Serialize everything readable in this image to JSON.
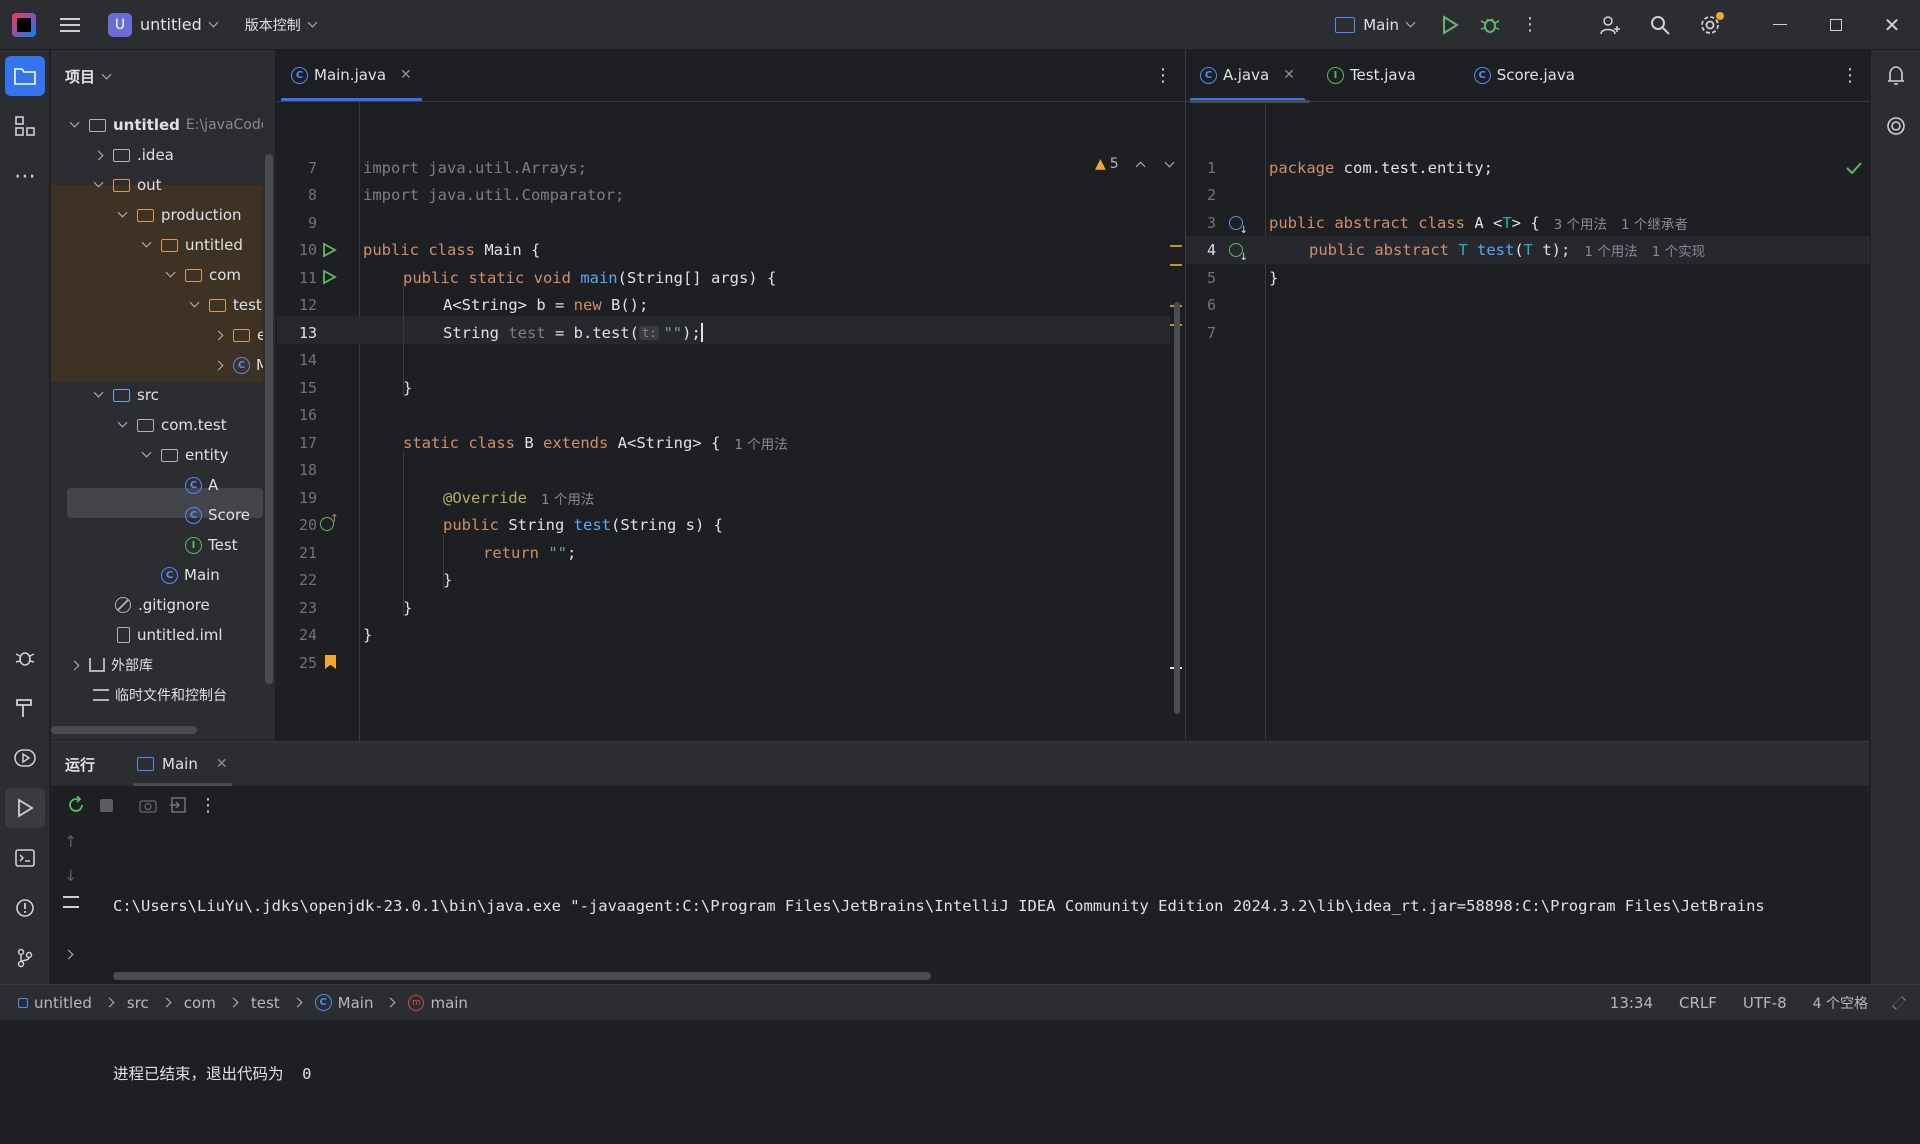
{
  "titlebar": {
    "project_badge": "U",
    "project_name": "untitled",
    "vcs_label": "版本控制",
    "run_config": "Main"
  },
  "project_panel": {
    "title": "项目",
    "root": {
      "name": "untitled",
      "path": "E:\\javaCode\\"
    },
    "items": [
      {
        "label": ".idea"
      },
      {
        "label": "out"
      },
      {
        "label": "production"
      },
      {
        "label": "untitled"
      },
      {
        "label": "com"
      },
      {
        "label": "test"
      },
      {
        "label": "en"
      },
      {
        "label": "M"
      },
      {
        "label": "src"
      },
      {
        "label": "com.test"
      },
      {
        "label": "entity"
      },
      {
        "label": "A"
      },
      {
        "label": "Score"
      },
      {
        "label": "Test"
      },
      {
        "label": "Main"
      },
      {
        "label": ".gitignore"
      },
      {
        "label": "untitled.iml"
      },
      {
        "label": "外部库"
      },
      {
        "label": "临时文件和控制台"
      }
    ]
  },
  "editor_left": {
    "tabs": [
      {
        "label": "Main.java"
      }
    ],
    "warning_count": "5",
    "lines": [
      {
        "n": "7",
        "t": "import java.util.Arrays;"
      },
      {
        "n": "8",
        "t": "import java.util.Comparator;"
      },
      {
        "n": "9",
        "t": ""
      },
      {
        "n": "10"
      },
      {
        "n": "11"
      },
      {
        "n": "12"
      },
      {
        "n": "13"
      },
      {
        "n": "14"
      },
      {
        "n": "15"
      },
      {
        "n": "16"
      },
      {
        "n": "17"
      },
      {
        "n": "18"
      },
      {
        "n": "19"
      },
      {
        "n": "20"
      },
      {
        "n": "21"
      },
      {
        "n": "22"
      },
      {
        "n": "23"
      },
      {
        "n": "24"
      },
      {
        "n": "25"
      }
    ],
    "code": {
      "l10a": "public class ",
      "l10b": "Main {",
      "l11a": "public static void ",
      "l11b": "main",
      "l11c": "(String[] args) {",
      "l12a": "A<String> b = ",
      "l12b": "new ",
      "l12c": "B();",
      "l13a": "String ",
      "l13b": "test",
      "l13c": " = b.test(",
      "l13d": "t:",
      "l13e": "\"\"",
      "l13f": ");",
      "l15": "}",
      "l17a": "static class ",
      "l17b": "B ",
      "l17c": "extends ",
      "l17d": "A<String> {",
      "l17hint": "1 个用法",
      "l19a": "@Override",
      "l19hint": "1 个用法",
      "l20a": "public ",
      "l20b": "String ",
      "l20c": "test",
      "l20d": "(String s) {",
      "l21a": "return ",
      "l21b": "\"\"",
      "l21c": ";",
      "l22": "}",
      "l23": "}",
      "l24": "}"
    }
  },
  "editor_right": {
    "tabs": [
      {
        "label": "A.java"
      },
      {
        "label": "Test.java"
      },
      {
        "label": "Score.java"
      }
    ],
    "lines": [
      {
        "n": "1"
      },
      {
        "n": "2"
      },
      {
        "n": "3"
      },
      {
        "n": "4"
      },
      {
        "n": "5"
      },
      {
        "n": "6"
      },
      {
        "n": "7"
      }
    ],
    "code": {
      "l1a": "package ",
      "l1b": "com.test.entity;",
      "l3a": "public abstract class ",
      "l3b": "A <",
      "l3c": "T",
      "l3d": "> {",
      "l3hint1": "3 个用法",
      "l3hint2": "1 个继承者",
      "l4a": "public abstract ",
      "l4b": "T ",
      "l4c": "test",
      "l4d": "(",
      "l4e": "T",
      "l4f": " t);",
      "l4hint1": "1 个用法",
      "l4hint2": "1 个实现",
      "l5": "}"
    }
  },
  "run_panel": {
    "title": "运行",
    "tab": "Main",
    "output_line1": "C:\\Users\\LiuYu\\.jdks\\openjdk-23.0.1\\bin\\java.exe \"-javaagent:C:\\Program Files\\JetBrains\\IntelliJ IDEA Community Edition 2024.3.2\\lib\\idea_rt.jar=58898:C:\\Program Files\\JetBrains",
    "output_line2": "进程已结束，退出代码为  0"
  },
  "statusbar": {
    "breadcrumbs": [
      "untitled",
      "src",
      "com",
      "test",
      "Main",
      "main"
    ],
    "position": "13:34",
    "line_ending": "CRLF",
    "encoding": "UTF-8",
    "indent": "4 个空格"
  },
  "colors": {
    "accent": "#3574f0",
    "keyword": "#cf8e6d",
    "string": "#6aab73",
    "function": "#56a8f5"
  }
}
